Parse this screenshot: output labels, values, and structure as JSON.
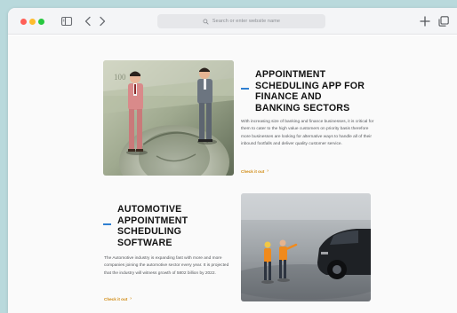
{
  "browser": {
    "address_placeholder": "Search or enter website name"
  },
  "section1": {
    "title_lines": [
      "APPOINTMENT",
      "SCHEDULING APP FOR",
      "FINANCE AND",
      "BANKING SECTORS"
    ],
    "body": "With increasing size of banking and finance businesses, it is critical for them to cater to the high value customers on priority basis therefore more businesses are looking for alternative ways to handle all of their inbound footfalls and deliver quality customer service.",
    "link": "Check it out"
  },
  "section2": {
    "title_lines": [
      "AUTOMOTIVE",
      "APPOINTMENT",
      "SCHEDULING",
      "SOFTWARE"
    ],
    "body": "The Automotive industry is expanding fast with more and more companies joining the automotive sector every year. It is projected that the industry will witness growth of 5802 billion by 2022.",
    "link": "Check it out"
  },
  "icons": {
    "sidebar": "sidebar-icon",
    "back": "chevron-left-icon",
    "forward": "chevron-right-icon",
    "search": "search-icon",
    "new_tab": "plus-icon",
    "tabs": "tabs-overview-icon",
    "link_arrow": "arrow-right-icon"
  },
  "colors": {
    "accent": "#2f7fd1",
    "link": "#d08a12",
    "traffic_red": "#ff5f57",
    "traffic_yellow": "#febc2e",
    "traffic_green": "#28c840"
  }
}
